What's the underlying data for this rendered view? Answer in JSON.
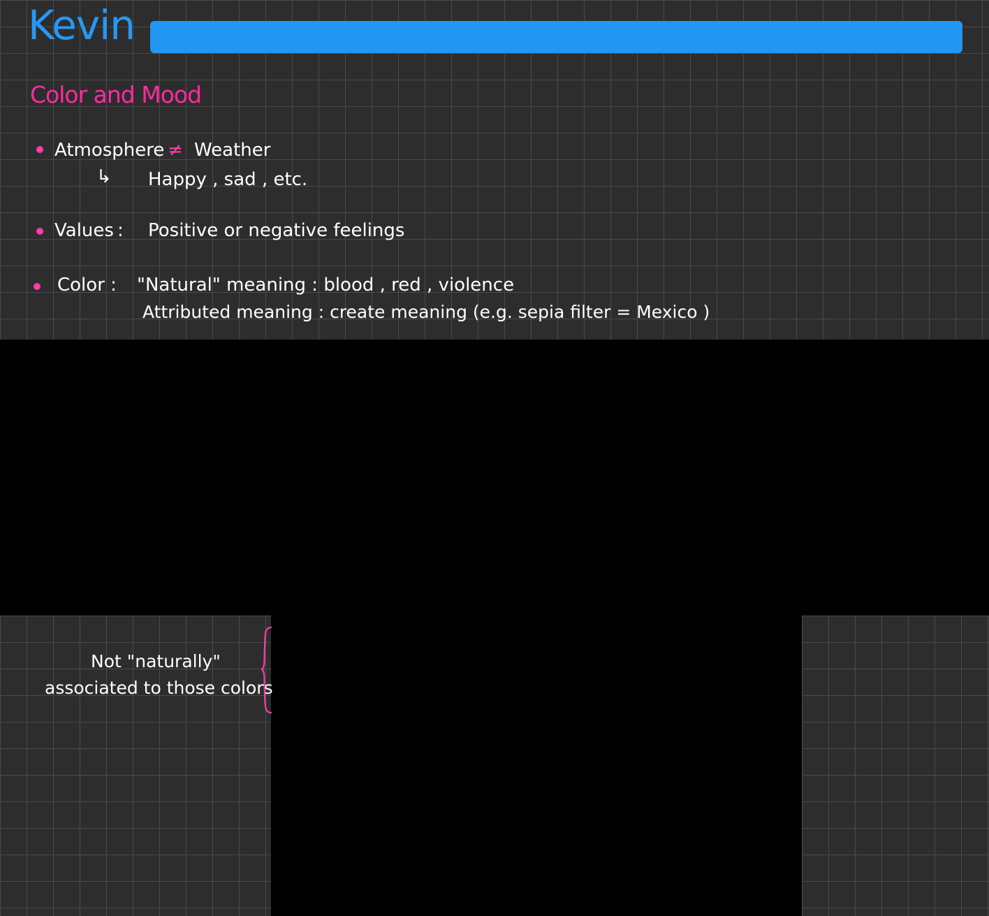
{
  "title": "Kevin",
  "section_heading": "Color and Mood",
  "colors": {
    "title": "#2798f5",
    "title_bar": "#2196f3",
    "heading": "#ff2ba0",
    "bullet": "#ff3ca8",
    "grid_bg": "#2d2d2d",
    "grid_line": "#4a4a4a"
  },
  "notes": {
    "atmosphere": {
      "term": "Atmosphere",
      "not_equal_symbol": "≠",
      "contrast": "Weather",
      "arrow": "↳",
      "example": "Happy , sad , etc."
    },
    "values": {
      "term": "Values",
      "colon": ":",
      "definition": "Positive or negative feelings"
    },
    "color": {
      "term": "Color :",
      "natural": "\"Natural\" meaning : blood , red , violence",
      "attributed": "Attributed meaning : create meaning (e.g. sepia filter = Mexico )"
    },
    "side_note": {
      "line1": "Not \"naturally\"",
      "line2": "associated to those colors"
    }
  }
}
